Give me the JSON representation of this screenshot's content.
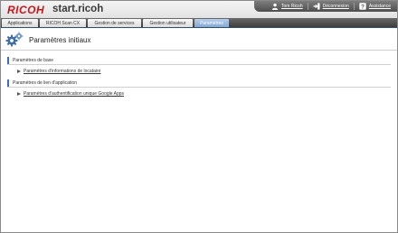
{
  "header": {
    "logo": "RICOH",
    "product": "start.ricoh"
  },
  "userbar": {
    "items": [
      {
        "label": "Tom Ricoh",
        "icon": "user-icon"
      },
      {
        "label": "Déconnexion",
        "icon": "logout-icon"
      },
      {
        "label": "Assistance",
        "icon": "help-icon"
      }
    ]
  },
  "nav": {
    "tabs": [
      {
        "label": "Applications",
        "active": false
      },
      {
        "label": "RICOH Scan CX",
        "active": false
      },
      {
        "label": "Gestion de services",
        "active": false
      },
      {
        "label": "Gestion utilisateur",
        "active": false
      },
      {
        "label": "Paramètres",
        "active": true
      }
    ]
  },
  "page": {
    "title": "Paramètres initiaux",
    "icon": "gears-icon"
  },
  "sections": [
    {
      "label": "Paramètres de base",
      "link": "Paramètres d'informations de locataire"
    },
    {
      "label": "Paramètres de lien d'application",
      "link": "Paramètres d'authentification unique Google Apps"
    }
  ],
  "colors": {
    "brand": "#c8161d",
    "active_tab": "#9ab9de",
    "section_marker": "#3d6fb0"
  }
}
